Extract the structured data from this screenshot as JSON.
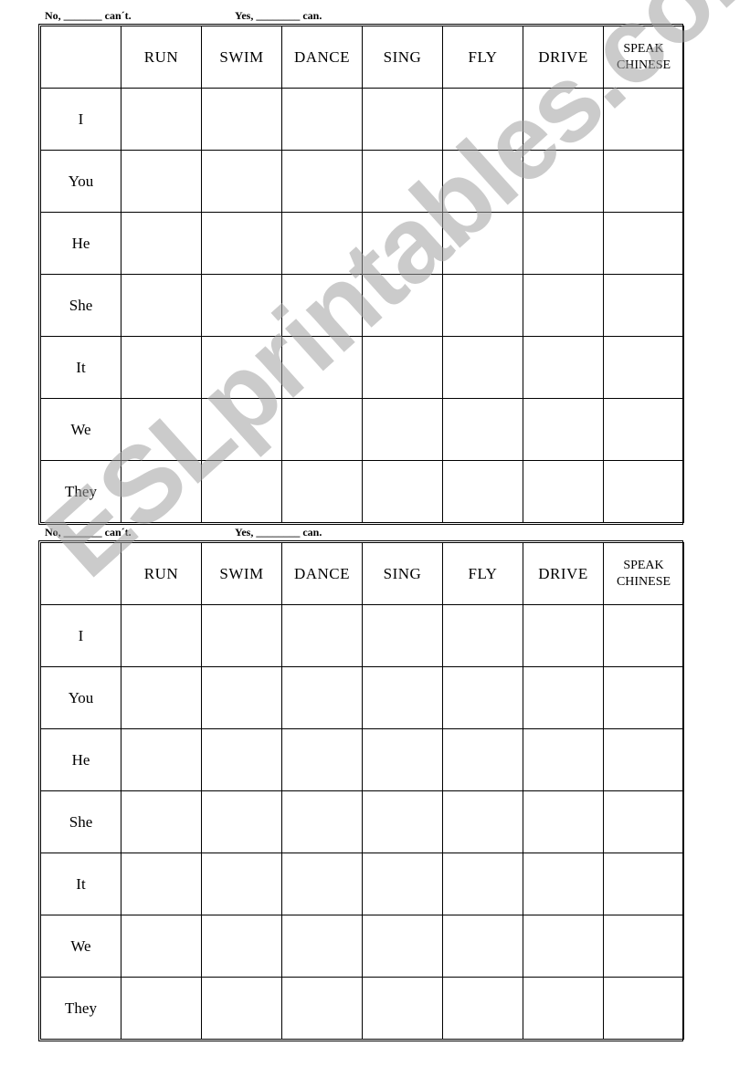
{
  "worksheets": [
    {
      "prompt": {
        "no": "No, _______ can´t.",
        "yes": "Yes, ________ can."
      },
      "columns": [
        "",
        "RUN",
        "SWIM",
        "DANCE",
        "SING",
        "FLY",
        "DRIVE",
        "SPEAK CHINESE"
      ],
      "speak_line1": "SPEAK",
      "speak_line2": "CHINESE",
      "rows": [
        "I",
        "You",
        "He",
        "She",
        "It",
        "We",
        "They"
      ]
    },
    {
      "prompt": {
        "no": "No, _______ can´t.",
        "yes": "Yes, ________ can."
      },
      "columns": [
        "",
        "RUN",
        "SWIM",
        "DANCE",
        "SING",
        "FLY",
        "DRIVE",
        "SPEAK CHINESE"
      ],
      "speak_line1": "SPEAK",
      "speak_line2": "CHINESE",
      "rows": [
        "I",
        "You",
        "He",
        "She",
        "It",
        "We",
        "They"
      ]
    }
  ],
  "watermark": "ESLprintables.com"
}
